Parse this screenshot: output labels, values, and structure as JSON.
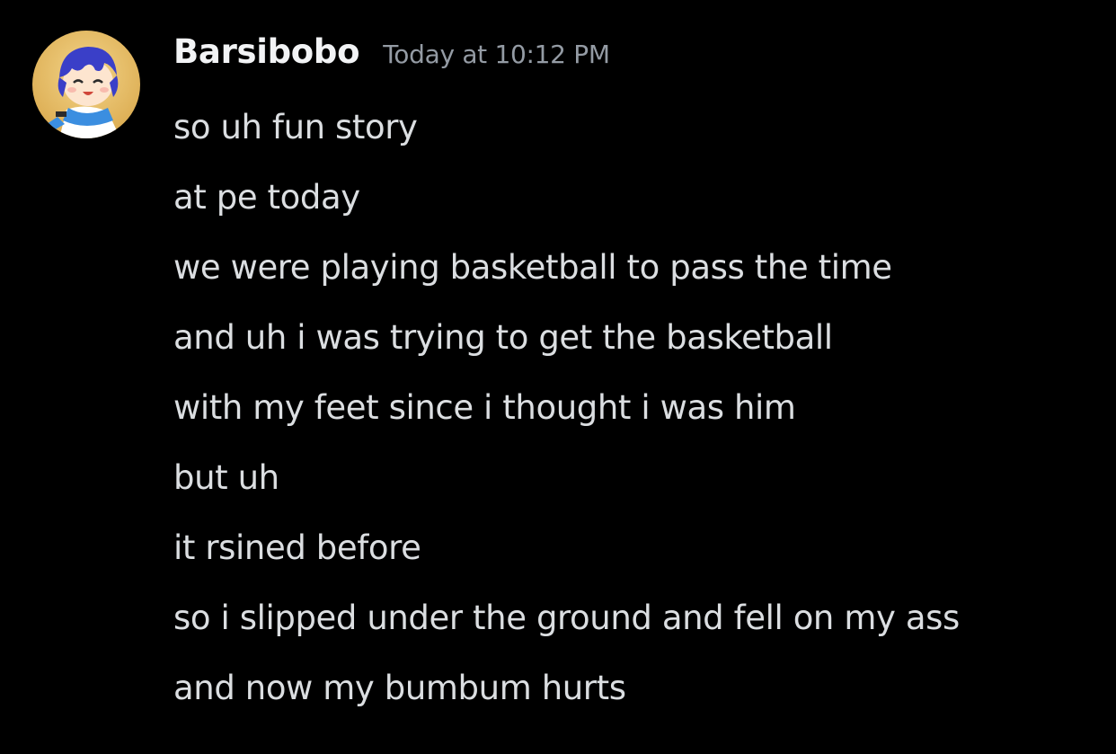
{
  "message": {
    "author": "Barsibobo",
    "timestamp": "Today at 10:12 PM",
    "avatar_icon": "anime-character-avatar-icon",
    "colors": {
      "background": "#000000",
      "author": "#f2f3f5",
      "timestamp": "#949ba4",
      "text": "#dbdee1"
    },
    "lines": [
      "so uh fun story",
      "at pe today",
      "we were playing basketball to pass the time",
      "and uh i was trying to get the basketball",
      "with my feet since i thought i was him",
      "but uh",
      "it rsined before",
      "so i slipped under the ground and fell on my ass",
      "and now my bumbum hurts"
    ]
  }
}
